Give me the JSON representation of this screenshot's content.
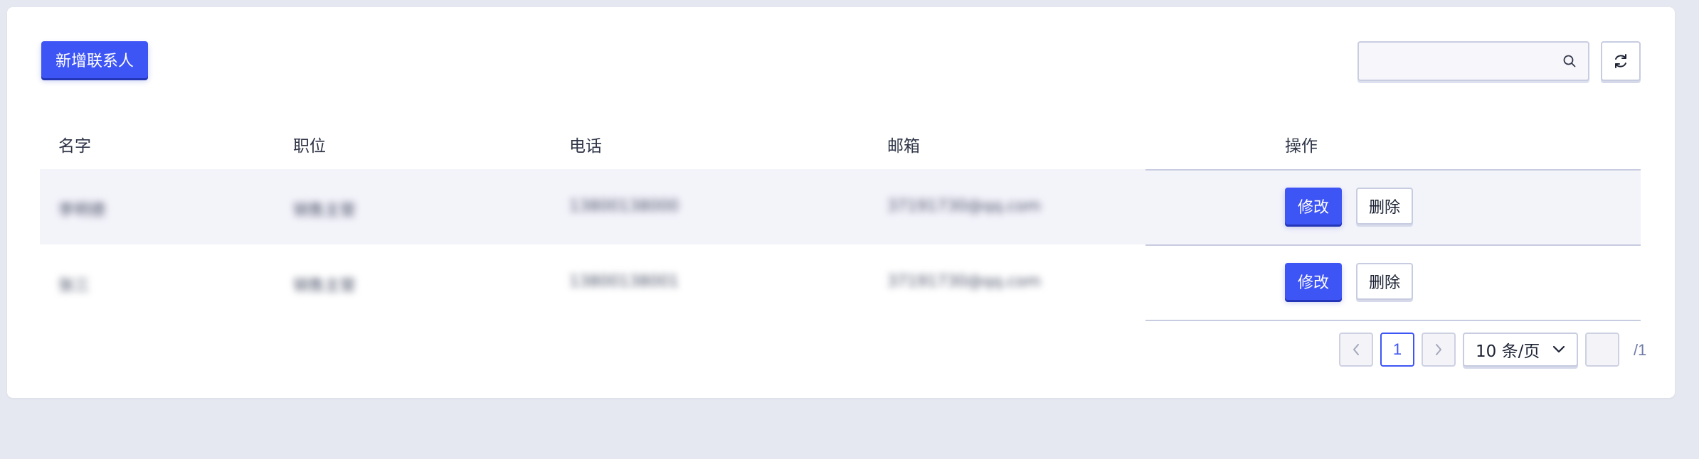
{
  "toolbar": {
    "add_label": "新增联系人",
    "search_placeholder": "",
    "search_icon": "search-icon",
    "refresh_icon": "refresh-icon"
  },
  "table": {
    "columns": [
      "名字",
      "职位",
      "电话",
      "邮箱",
      "操作"
    ],
    "rows": [
      {
        "name": "李明德",
        "position": "销售主管",
        "phone": "13800138000",
        "email": "37191730@qq.com",
        "edit": "修改",
        "delete": "删除"
      },
      {
        "name": "张三",
        "position": "销售主管",
        "phone": "13800138001",
        "email": "37191730@qq.com",
        "edit": "修改",
        "delete": "删除"
      }
    ]
  },
  "pagination": {
    "current_page": "1",
    "page_size_label": "10 条/页",
    "jump_value": "",
    "total_label": "/1"
  },
  "colors": {
    "primary": "#3e55f5",
    "background": "#e6e8f1",
    "row_highlight": "#f3f3fa"
  }
}
